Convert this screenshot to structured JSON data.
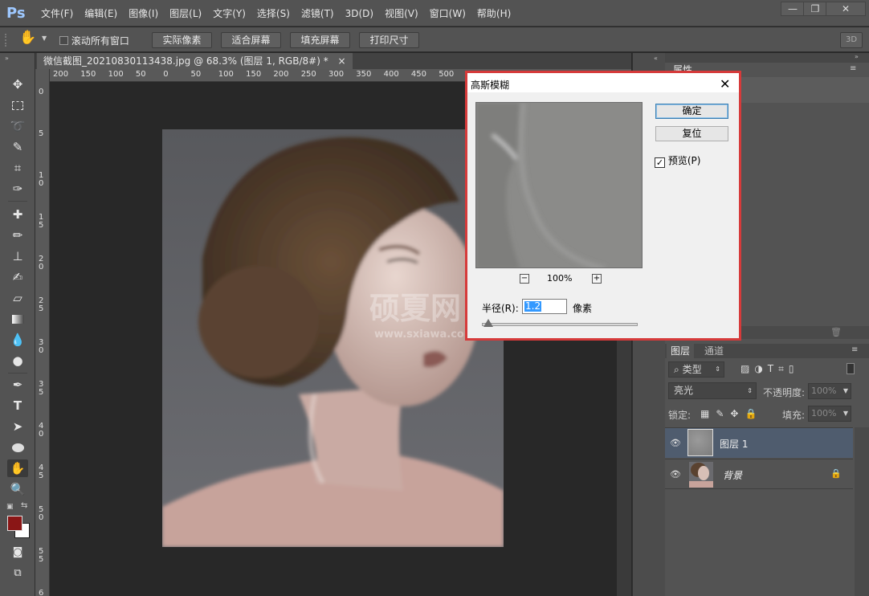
{
  "app": {
    "logo": "Ps"
  },
  "menu": [
    "文件(F)",
    "编辑(E)",
    "图像(I)",
    "图层(L)",
    "文字(Y)",
    "选择(S)",
    "滤镜(T)",
    "3D(D)",
    "视图(V)",
    "窗口(W)",
    "帮助(H)"
  ],
  "window_buttons": {
    "minimize": "—",
    "restore": "❐",
    "close": "✕"
  },
  "options_bar": {
    "scroll_all_label": "滚动所有窗口",
    "actual_pixels": "实际像素",
    "fit_screen": "适合屏幕",
    "fill_screen": "填充屏幕",
    "print_size": "打印尺寸",
    "workspace": "3D"
  },
  "document": {
    "tab_title": "微信截图_20210830113438.jpg @ 68.3% (图层 1, RGB/8#) *",
    "tab_close": "×",
    "ruler_top": [
      "200",
      "150",
      "100",
      "50",
      "0",
      "50",
      "100",
      "150",
      "200",
      "250",
      "300",
      "350",
      "400",
      "450",
      "500"
    ],
    "ruler_left": [
      "0",
      "5",
      "1\n0",
      "1\n5",
      "2\n0",
      "2\n5",
      "3\n0",
      "3\n5",
      "4\n0",
      "4\n5",
      "5\n0",
      "5\n5",
      "6\n0"
    ]
  },
  "watermark": {
    "text": "硕夏网",
    "url": "www.sxiawa.com"
  },
  "properties_panel": {
    "tab": "属性"
  },
  "layers_panel": {
    "tab_layers": "图层",
    "tab_channels": "通道",
    "filter_kind": "类型",
    "blend_mode": "亮光",
    "opacity_label": "不透明度:",
    "opacity_value": "100%",
    "lock_label": "锁定:",
    "fill_label": "填充:",
    "fill_value": "100%",
    "layers": [
      {
        "name": "图层 1",
        "selected": true
      },
      {
        "name": "背景",
        "selected": false,
        "locked": true
      }
    ]
  },
  "dialog": {
    "title": "高斯模糊",
    "ok": "确定",
    "reset": "复位",
    "preview_label": "预览(P)",
    "preview_checked": true,
    "zoom": "100%",
    "radius_label": "半径(R):",
    "radius_value": "1.2",
    "unit": "像素",
    "radius_slider_fraction": 0.04
  },
  "colors": {
    "foreground": "#8a1616",
    "background": "#ffffff",
    "dialog_border": "#d63a3a",
    "selected_layer": "#4f5c6e"
  }
}
